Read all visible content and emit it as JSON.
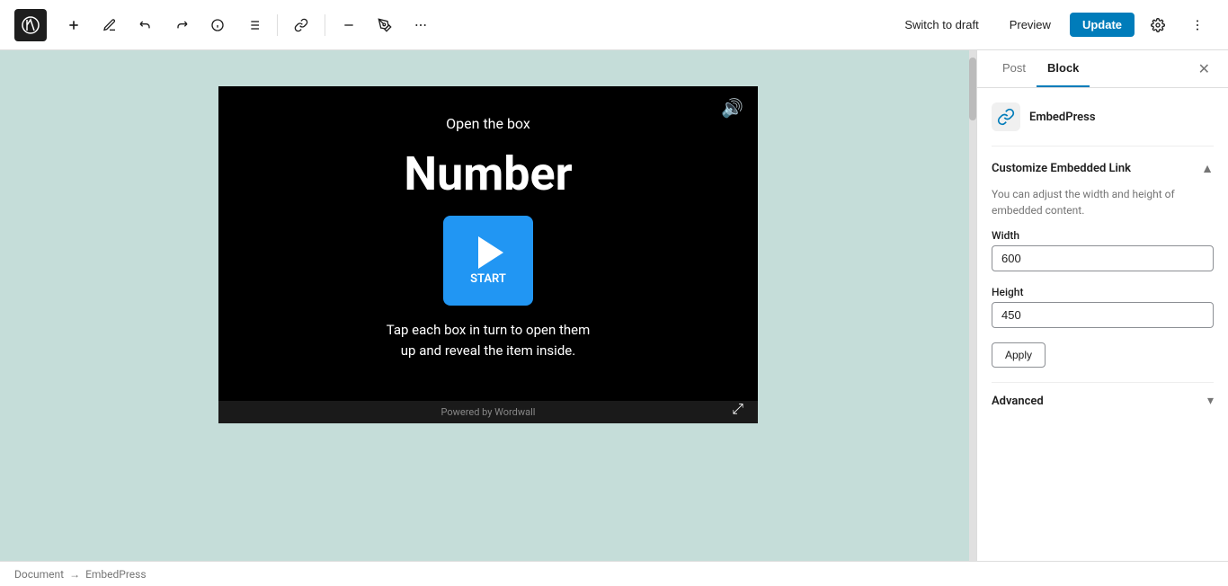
{
  "toolbar": {
    "add_label": "+",
    "update_label": "Update",
    "switch_to_draft_label": "Switch to draft",
    "preview_label": "Preview"
  },
  "sidebar": {
    "post_tab": "Post",
    "block_tab": "Block",
    "plugin_name": "EmbedPress",
    "section_title": "Customize Embedded Link",
    "section_desc": "You can adjust the width and height of embedded content.",
    "width_label": "Width",
    "width_value": "600",
    "height_label": "Height",
    "height_value": "450",
    "apply_label": "Apply",
    "advanced_label": "Advanced"
  },
  "embed": {
    "title": "Open the box",
    "heading": "Number",
    "start_label": "START",
    "description": "Tap each box in turn to open them\nup and reveal the item inside.",
    "footer": "Powered by Wordwall"
  },
  "breadcrumb": {
    "document_label": "Document",
    "arrow": "→",
    "plugin_label": "EmbedPress"
  }
}
